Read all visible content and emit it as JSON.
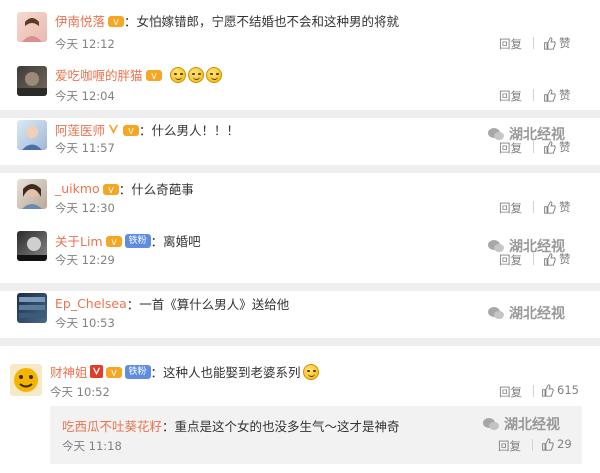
{
  "comments": [
    {
      "name": "伊南悦落",
      "text": "：女怕嫁错郎，宁愿不结婚也不会和这种男的将就",
      "time": "今天 12:12",
      "reply": "回复",
      "like": "赞"
    },
    {
      "name": "爱吃咖喱的胖猫",
      "text": "",
      "time": "今天 12:04",
      "reply": "回复",
      "like": "赞"
    },
    {
      "name": "阿莲医师",
      "text": "：什么男人！！！",
      "time": "今天 11:57",
      "reply": "回复",
      "like": "赞"
    },
    {
      "name": "_uikmo",
      "text": "：什么奇葩事",
      "time": "今天 12:30",
      "reply": "回复",
      "like": "赞"
    },
    {
      "name": "关于Lim",
      "fan": "铁粉",
      "text": "：离婚吧",
      "time": "今天 12:29",
      "reply": "回复",
      "like": "赞"
    },
    {
      "name": "Ep_Chelsea",
      "text": "：一首《算什么男人》送给他",
      "time": "今天 10:53",
      "reply": "回复",
      "like": "赞"
    },
    {
      "name": "财神姐",
      "fan": "铁粉",
      "text": "：这种人也能娶到老婆系列",
      "time": "今天 10:52",
      "reply": "回复",
      "like": "615"
    }
  ],
  "sub_reply": {
    "name": "吃西瓜不吐葵花籽",
    "text": "：重点是这个女的也没多生气～这才是神奇",
    "time": "今天 11:18",
    "reply": "回复",
    "like": "29"
  },
  "watermark": "湖北经视",
  "colors": {
    "name": "#eb7350",
    "fan_badge": "#5e8de2",
    "separator": "#eeeeee"
  }
}
